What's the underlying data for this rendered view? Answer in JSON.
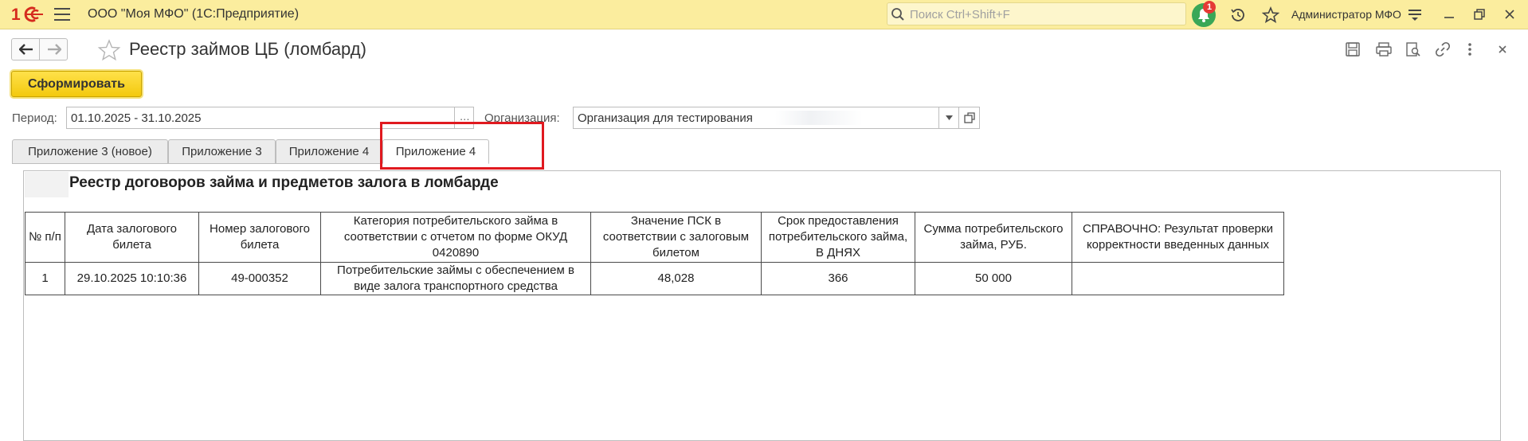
{
  "topbar": {
    "app_title": "ООО \"Моя МФО\"  (1С:Предприятие)",
    "search_placeholder": "Поиск Ctrl+Shift+F",
    "notifications_count": "1",
    "user_name": "Администратор МФО"
  },
  "form": {
    "title": "Реестр займов ЦБ (ломбард)",
    "generate_button": "Сформировать",
    "period_label": "Период:",
    "period_value": "01.10.2025 - 31.10.2025",
    "period_choose": "...",
    "org_label": "Организация:",
    "org_value": "Организация для тестирования"
  },
  "tabs": [
    {
      "label": "Приложение 3 (новое)",
      "active": false
    },
    {
      "label": "Приложение 3",
      "active": false
    },
    {
      "label": "Приложение 4",
      "active": false
    },
    {
      "label": "Приложение 4",
      "active": true
    }
  ],
  "report": {
    "title": "Реестр договоров займа и предметов залога в ломбарде",
    "headers": [
      "№ п/п",
      "Дата залогового билета",
      "Номер залогового билета",
      "Категория потребительского займа в соответствии с отчетом по форме ОКУД 0420890",
      "Значение ПСК в соответствии с залоговым билетом",
      "Срок предоставления потребительского займа, В ДНЯХ",
      "Сумма потребительского займа, РУБ.",
      "СПРАВОЧНО: Результат проверки корректности введенных данных"
    ],
    "rows": [
      [
        "1",
        "29.10.2025 10:10:36",
        "49-000352",
        "Потребительские займы с обеспечением в виде залога транспортного средства",
        "48,028",
        "366",
        "50 000",
        ""
      ]
    ]
  },
  "colors": {
    "topbar_bg": "#fbed9e",
    "accent_yellow": "#f3c90d",
    "highlight_red": "#e0191f",
    "notification_green": "#3aa757"
  }
}
